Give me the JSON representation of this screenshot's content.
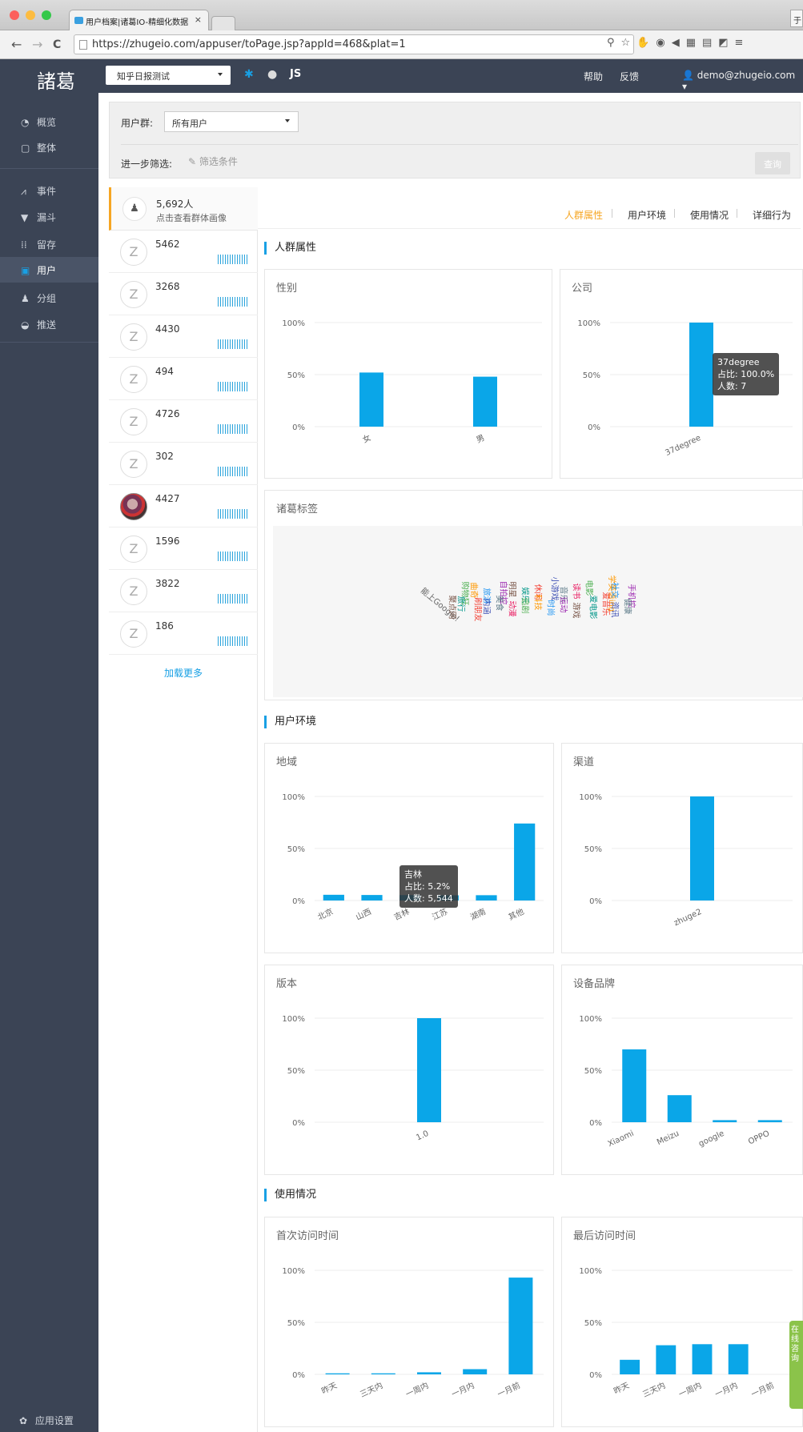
{
  "browser": {
    "tab_title": "用户档案|诸葛IO-精细化数据",
    "tab_close": "×",
    "corner_label": "于",
    "url": "https://zhugeio.com/appuser/toPage.jsp?appId=468&plat=1",
    "nav": {
      "back": "←",
      "forward": "→",
      "reload": "C"
    }
  },
  "header": {
    "logo": "諸葛",
    "app_selected": "知乎日报测试",
    "platforms": [
      "JS"
    ],
    "help": "帮助",
    "feedback": "反馈",
    "user": "demo@zhugeio.com"
  },
  "sidebar": {
    "items": [
      {
        "label": "概览",
        "icon": "dashboard-icon"
      },
      {
        "label": "整体",
        "icon": "overview-icon"
      },
      {
        "label": "事件",
        "icon": "line-chart-icon"
      },
      {
        "label": "漏斗",
        "icon": "funnel-icon"
      },
      {
        "label": "留存",
        "icon": "retention-icon"
      },
      {
        "label": "用户",
        "icon": "user-icon"
      },
      {
        "label": "分组",
        "icon": "group-icon"
      },
      {
        "label": "推送",
        "icon": "push-icon"
      }
    ],
    "settings": "应用设置"
  },
  "filter": {
    "group_label": "用户群:",
    "group_value": "所有用户",
    "more_label": "进一步筛选:",
    "condition": "筛选条件",
    "query": "查询"
  },
  "user_list": {
    "group_count": "5,692人",
    "group_sub": "点击查看群体画像",
    "users": [
      {
        "id": "5462"
      },
      {
        "id": "3268"
      },
      {
        "id": "4430"
      },
      {
        "id": "494"
      },
      {
        "id": "4726"
      },
      {
        "id": "302"
      },
      {
        "id": "4427",
        "photo": true
      },
      {
        "id": "1596"
      },
      {
        "id": "3822"
      },
      {
        "id": "186"
      }
    ],
    "load_more": "加载更多"
  },
  "tabs": [
    "人群属性",
    "用户环境",
    "使用情况",
    "详细行为"
  ],
  "sections": {
    "crowd": "人群属性",
    "env": "用户环境",
    "usage": "使用情况"
  },
  "tag_panel": {
    "title": "诸葛标签",
    "tags": [
      "能上Google!",
      "购物狂",
      "曲奇",
      "旅游",
      "自拍控",
      "明星",
      "娱乐",
      "休闲",
      "小游戏",
      "音乐",
      "读书",
      "电影",
      "学英语ing",
      "社交",
      "手机控",
      "聚点网",
      "旅行",
      "刷朋友",
      "内涵",
      "美食",
      "动漫",
      "追剧",
      "科技",
      "时尚",
      "运动",
      "游戏",
      "爱电影",
      "爱音乐",
      "资讯",
      "健康"
    ]
  },
  "chart_data": [
    {
      "id": "gender",
      "title": "性别",
      "type": "bar",
      "categories": [
        "女",
        "男"
      ],
      "values": [
        52,
        48
      ],
      "ylim": [
        0,
        100
      ],
      "yticks": [
        "0%",
        "50%",
        "100%"
      ]
    },
    {
      "id": "company",
      "title": "公司",
      "type": "bar",
      "categories": [
        "37degree"
      ],
      "values": [
        100
      ],
      "ylim": [
        0,
        100
      ],
      "yticks": [
        "0%",
        "50%",
        "100%"
      ],
      "tooltip": {
        "name": "37degree",
        "share": "占比: 100.0%",
        "count": "人数: 7"
      }
    },
    {
      "id": "region",
      "title": "地域",
      "type": "bar",
      "categories": [
        "北京",
        "山西",
        "吉林",
        "江苏",
        "湖南",
        "其他"
      ],
      "values": [
        5.5,
        5.3,
        5.2,
        5.0,
        5.1,
        74
      ],
      "ylim": [
        0,
        100
      ],
      "yticks": [
        "0%",
        "50%",
        "100%"
      ],
      "tooltip": {
        "name": "吉林",
        "share": "占比: 5.2%",
        "count": "人数: 5,544"
      }
    },
    {
      "id": "channel",
      "title": "渠道",
      "type": "bar",
      "categories": [
        "zhuge2"
      ],
      "values": [
        100
      ],
      "ylim": [
        0,
        100
      ],
      "yticks": [
        "0%",
        "50%",
        "100%"
      ]
    },
    {
      "id": "version",
      "title": "版本",
      "type": "bar",
      "categories": [
        "1.0"
      ],
      "values": [
        100
      ],
      "ylim": [
        0,
        100
      ],
      "yticks": [
        "0%",
        "50%",
        "100%"
      ]
    },
    {
      "id": "brand",
      "title": "设备品牌",
      "type": "bar",
      "categories": [
        "Xiaomi",
        "Meizu",
        "google",
        "OPPO"
      ],
      "values": [
        70,
        26,
        2,
        2
      ],
      "ylim": [
        0,
        100
      ],
      "yticks": [
        "0%",
        "50%",
        "100%"
      ]
    },
    {
      "id": "first_visit",
      "title": "首次访问时间",
      "type": "bar",
      "categories": [
        "昨天",
        "三天内",
        "一周内",
        "一月内",
        "一月前"
      ],
      "values": [
        1,
        1,
        2,
        5,
        93
      ],
      "ylim": [
        0,
        100
      ],
      "yticks": [
        "0%",
        "50%",
        "100%"
      ]
    },
    {
      "id": "last_visit",
      "title": "最后访问时间",
      "type": "bar",
      "categories": [
        "昨天",
        "三天内",
        "一周内",
        "一月内",
        "一月前"
      ],
      "values": [
        14,
        28,
        29,
        29,
        0
      ],
      "ylim": [
        0,
        100
      ],
      "yticks": [
        "0%",
        "50%",
        "100%"
      ]
    }
  ],
  "chat_widget": "在线咨询",
  "colors": {
    "accent": "#18a0e4",
    "bar": "#0aa6e8",
    "active_tab": "#f6a623",
    "sidebar": "#3b4455"
  }
}
